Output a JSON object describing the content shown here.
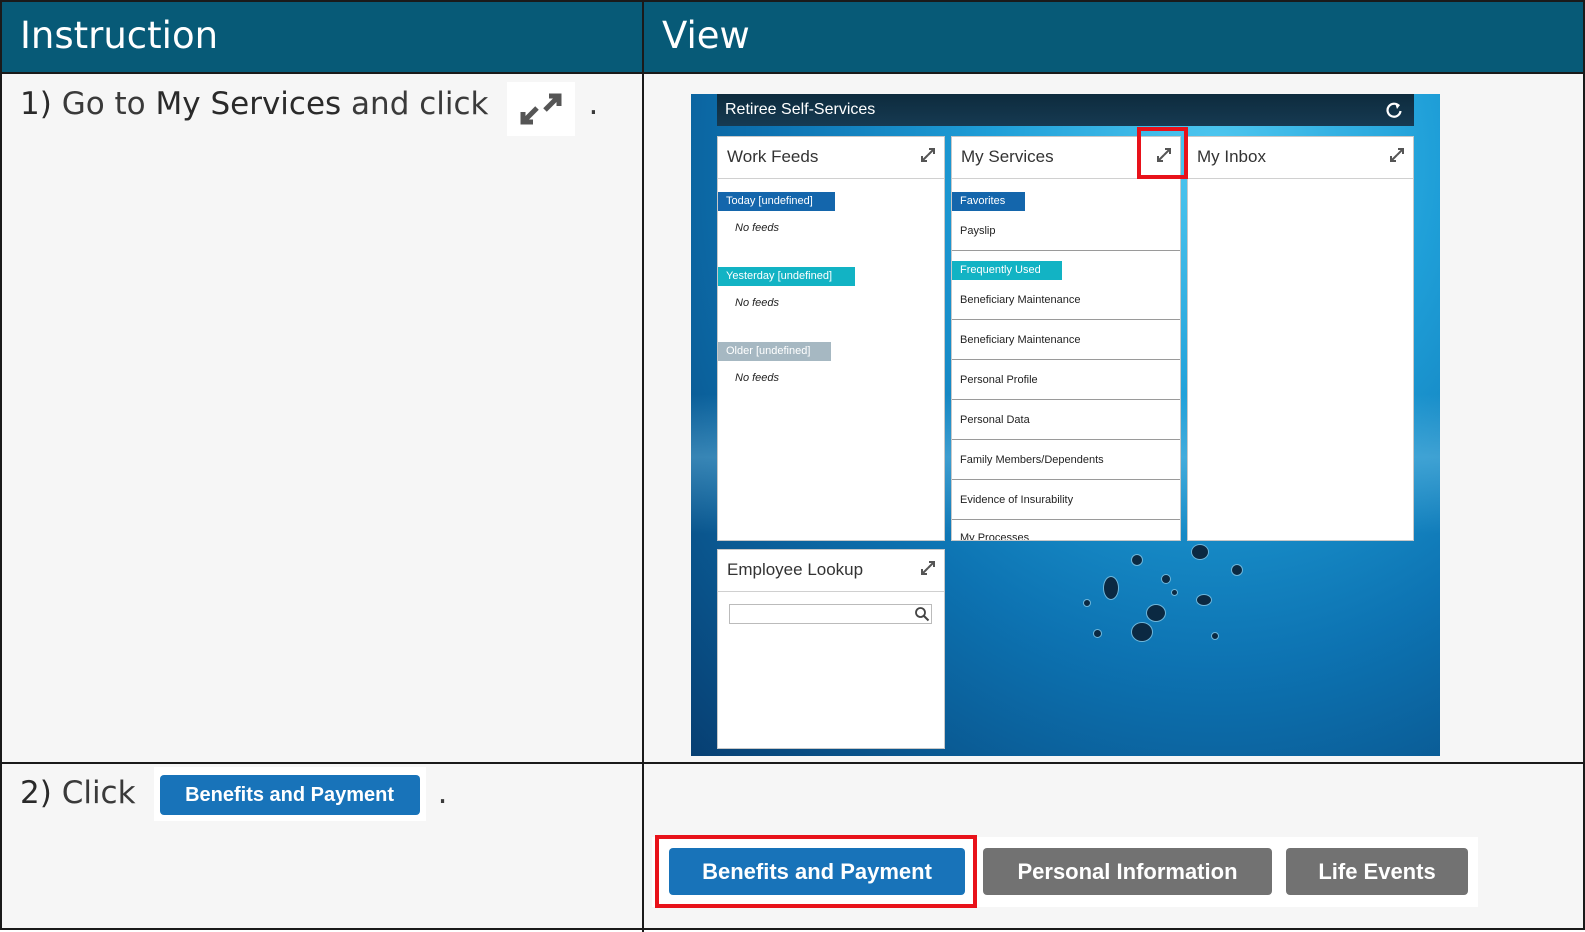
{
  "headers": {
    "instruction": "Instruction",
    "view": "View"
  },
  "step1": {
    "num": "1)",
    "text_before": "Go to",
    "emphasis": "My Services",
    "text_after": "and click",
    "period": ".",
    "icon": "expand-arrows-icon"
  },
  "step2": {
    "num": "2)",
    "text_before": "Click",
    "button_label": "Benefits and Payment",
    "period": "."
  },
  "portal": {
    "title": "Retiree Self-Services",
    "refresh_icon": "refresh-icon",
    "work_feeds": {
      "title": "Work Feeds",
      "groups": [
        {
          "label": "Today [undefined]",
          "empty": "No feeds",
          "color": "#1466ac"
        },
        {
          "label": "Yesterday [undefined]",
          "empty": "No feeds",
          "color": "#12b3c4"
        },
        {
          "label": "Older [undefined]",
          "empty": "No feeds",
          "color": "#a6b8c2"
        }
      ]
    },
    "my_services": {
      "title": "My Services",
      "favorites_label": "Favorites",
      "favorites": [
        "Payslip"
      ],
      "frequent_label": "Frequently Used",
      "frequent": [
        "Beneficiary Maintenance",
        "Beneficiary Maintenance",
        "Personal Profile",
        "Personal Data",
        "Family Members/Dependents",
        "Evidence of Insurability",
        "My Processes"
      ]
    },
    "my_inbox": {
      "title": "My Inbox"
    },
    "employee_lookup": {
      "title": "Employee Lookup",
      "search_placeholder": ""
    }
  },
  "tabs": {
    "items": [
      "Benefits and Payment",
      "Personal Information",
      "Life Events"
    ],
    "selected": "Benefits and Payment"
  },
  "colors": {
    "header_bg": "#075a77",
    "highlight": "#e8121a",
    "primary_button": "#1873b9",
    "secondary_button": "#727272"
  }
}
